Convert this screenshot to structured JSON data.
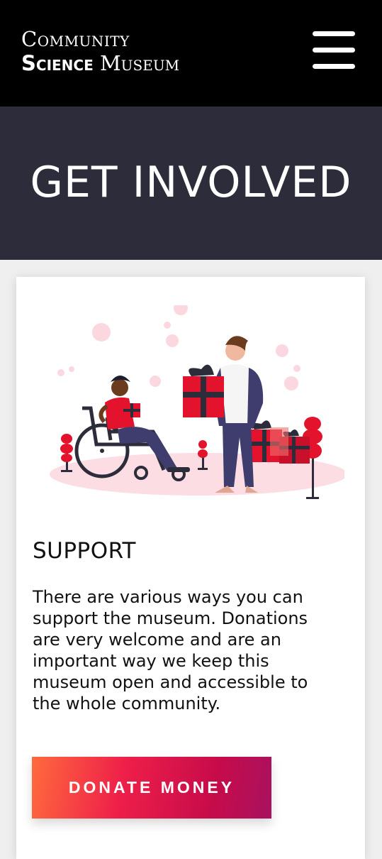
{
  "header": {
    "logo_line1": "Community",
    "logo_line2_bold": "Science",
    "logo_line2_rest": " Museum"
  },
  "hero": {
    "title": "GET INVOLVED"
  },
  "support": {
    "title": "SUPPORT",
    "text": "There are various ways you can support the museum. Donations are very welcome and are an important way we keep this museum open and accessible to the whole community.",
    "button_label": "DONATE MONEY"
  },
  "colors": {
    "header_bg": "#000000",
    "hero_bg": "#2d2c3b",
    "accent_red": "#ee1f49",
    "accent_orange": "#ff6a3d",
    "accent_purple": "#a8125f",
    "navy": "#3f3d6e"
  },
  "icons": {
    "menu": "hamburger-menu-icon",
    "illustration": "gift-giving-illustration"
  }
}
